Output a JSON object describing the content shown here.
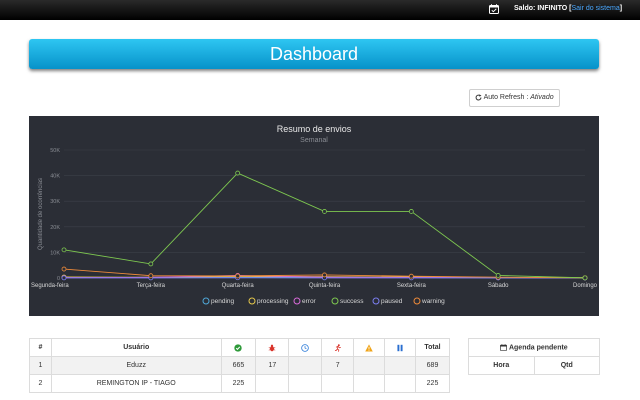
{
  "topbar": {
    "saldo_label": "Saldo:",
    "saldo_value": "INFINITO",
    "bracket_open": "[",
    "logout_link": "Sair do sistema",
    "bracket_close": "]",
    "icon": "calendar-check-icon"
  },
  "page": {
    "title": "Dashboard"
  },
  "refresh": {
    "label": "Auto Refresh :",
    "status": "Ativado",
    "icon": "refresh-icon"
  },
  "chart_data": {
    "type": "line",
    "title": "Resumo de envios",
    "subtitle": "Semanal",
    "ylabel": "Quantidade de ocorrências",
    "xlabel": "",
    "categories": [
      "Segunda-feira",
      "Terça-feira",
      "Quarta-feira",
      "Quinta-feira",
      "Sexta-feira",
      "Sábado",
      "Domingo"
    ],
    "y_ticks": [
      "0",
      "10K",
      "20K",
      "30K",
      "40K",
      "50K"
    ],
    "ylim": [
      0,
      50000
    ],
    "grid": true,
    "legend_position": "bottom",
    "series": [
      {
        "name": "pending",
        "color": "#4fa8d8",
        "values": [
          200,
          150,
          300,
          200,
          150,
          100,
          50
        ]
      },
      {
        "name": "processing",
        "color": "#e6c84a",
        "values": [
          400,
          300,
          600,
          500,
          400,
          200,
          50
        ]
      },
      {
        "name": "error",
        "color": "#d86ad8",
        "values": [
          150,
          250,
          1000,
          300,
          250,
          100,
          30
        ]
      },
      {
        "name": "success",
        "color": "#7ec850",
        "values": [
          11000,
          5500,
          41000,
          26000,
          26000,
          1000,
          50
        ]
      },
      {
        "name": "paused",
        "color": "#7b7ef0",
        "values": [
          50,
          50,
          100,
          50,
          50,
          30,
          10
        ]
      },
      {
        "name": "warning",
        "color": "#ee8a3a",
        "values": [
          3500,
          900,
          800,
          1200,
          700,
          300,
          100
        ]
      }
    ]
  },
  "users_table": {
    "headers": {
      "num": "#",
      "user": "Usuário",
      "total": "Total"
    },
    "icons": {
      "success": "check-circle-icon",
      "bug": "bug-icon",
      "clock": "clock-icon",
      "run": "running-person-icon",
      "warn": "warning-triangle-icon",
      "pause": "pause-icon"
    },
    "rows": [
      {
        "num": "1",
        "user": "Eduzz",
        "c1": "665",
        "c2": "17",
        "c3": "",
        "c4": "7",
        "c5": "",
        "c6": "",
        "total": "689"
      },
      {
        "num": "2",
        "user": "REMINGTON IP - TIAGO",
        "c1": "225",
        "c2": "",
        "c3": "",
        "c4": "",
        "c5": "",
        "c6": "",
        "total": "225"
      }
    ]
  },
  "agenda": {
    "title": "Agenda pendente",
    "icon": "calendar-icon",
    "col_hora": "Hora",
    "col_qtd": "Qtd"
  }
}
